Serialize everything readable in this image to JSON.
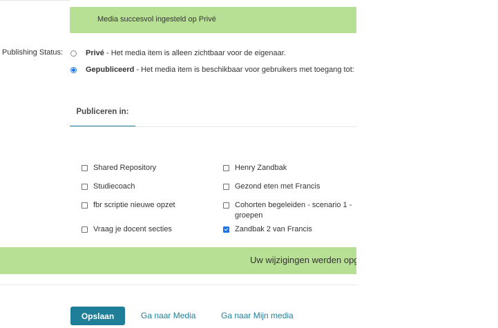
{
  "alerts": {
    "top_message": "Media succesvol ingesteld op Privé",
    "bottom_message": "Uw wijzigingen werden opgeslagen"
  },
  "publishing": {
    "label": "Publishing Status:",
    "options": [
      {
        "title": "Privé",
        "desc": " - Het media item is alleen zichtbaar voor de eigenaar.",
        "checked": false
      },
      {
        "title": "Gepubliceerd",
        "desc": " - Het media item is beschikbaar voor gebruikers met toegang tot:",
        "checked": true
      }
    ]
  },
  "tabs": {
    "publish_in": "Publiceren in:"
  },
  "channels": [
    {
      "label": "Shared Repository",
      "checked": false
    },
    {
      "label": "Henry Zandbak",
      "checked": false
    },
    {
      "label": "Studiecoach",
      "checked": false
    },
    {
      "label": "Gezond eten met Francis",
      "checked": false
    },
    {
      "label": "fbr scriptie nieuwe opzet",
      "checked": false
    },
    {
      "label": "Cohorten begeleiden - scenario 1 - groepen",
      "checked": false
    },
    {
      "label": "Vraag je docent secties",
      "checked": false
    },
    {
      "label": "Zandbak 2 van Francis",
      "checked": true
    }
  ],
  "actions": {
    "save": "Opslaan",
    "goto_media": "Ga naar Media",
    "goto_my_media": "Ga naar Mijn media"
  },
  "colors": {
    "accent": "#1f7f99",
    "success_bg": "#b8e095",
    "radio_checked": "#1a73e8"
  }
}
